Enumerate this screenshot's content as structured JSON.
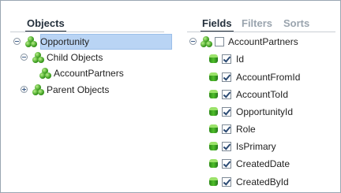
{
  "left": {
    "tabs": [
      {
        "label": "Objects",
        "active": true
      }
    ],
    "tree": [
      {
        "label": "Opportunity",
        "expander": "minus",
        "icon": "object-group-icon"
      },
      {
        "label": "Child Objects",
        "expander": "minus",
        "icon": "object-group-icon"
      },
      {
        "label": "AccountPartners",
        "expander": "none",
        "icon": "object-group-icon",
        "selected": true
      },
      {
        "label": "Parent Objects",
        "expander": "plus",
        "icon": "object-group-icon"
      }
    ]
  },
  "right": {
    "tabs": [
      {
        "label": "Fields",
        "active": true
      },
      {
        "label": "Filters",
        "active": false
      },
      {
        "label": "Sorts",
        "active": false
      }
    ],
    "root": {
      "label": "AccountPartners",
      "checked": false,
      "expander": "minus"
    },
    "fields": [
      {
        "label": "Id",
        "checked": true
      },
      {
        "label": "AccountFromId",
        "checked": true
      },
      {
        "label": "AccountToId",
        "checked": true
      },
      {
        "label": "OpportunityId",
        "checked": true
      },
      {
        "label": "Role",
        "checked": true
      },
      {
        "label": "IsPrimary",
        "checked": true
      },
      {
        "label": "CreatedDate",
        "checked": true
      },
      {
        "label": "CreatedById",
        "checked": true
      }
    ]
  },
  "colors": {
    "selection": "#b9d4f4",
    "tab_active": "#24303c",
    "tab_inactive": "#9aa4ae",
    "icon_green": "#3c9d1f"
  }
}
